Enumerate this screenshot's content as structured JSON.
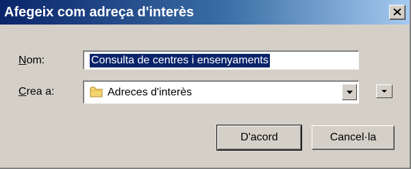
{
  "window": {
    "title": "Afegeix com adreça d'interès",
    "close_icon": "close-icon"
  },
  "form": {
    "name_label_accel": "N",
    "name_label_rest": "om:",
    "name_value": "Consulta de centres i ensenyaments",
    "create_label_accel": "C",
    "create_label_rest": "rea a:",
    "create_value": "Adreces d'interès",
    "folder_icon": "folder-icon",
    "dropdown_icon": "chevron-down-icon",
    "expand_icon": "chevron-down-icon"
  },
  "buttons": {
    "ok": "D'acord",
    "cancel": "Cancel·la"
  },
  "colors": {
    "titlebar_start": "#0a246a",
    "titlebar_end": "#a6caf0",
    "dialog_bg": "#d4d0c8",
    "selection_bg": "#0a246a"
  }
}
